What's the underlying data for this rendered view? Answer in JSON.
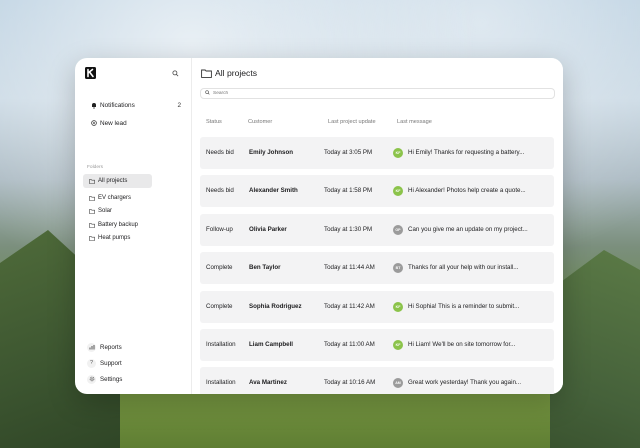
{
  "colors": {
    "accent_green": "#8bc34a",
    "avatar_gray": "#9b9b9b",
    "active_folder_bg": "#e9e9ea",
    "row_bg": "#f3f3f4"
  },
  "sidebar": {
    "logo_icon": "brand-logo-icon",
    "search_icon": "search-icon",
    "notifications": {
      "label": "Notifications",
      "count": "2",
      "icon": "bell-icon"
    },
    "new_lead": {
      "label": "New lead",
      "icon": "plus-circle-icon"
    },
    "folders_label": "Folders",
    "folders": [
      {
        "label": "All projects",
        "icon": "folder-icon",
        "active": true
      },
      {
        "label": "EV chargers",
        "icon": "folder-icon"
      },
      {
        "label": "Solar",
        "icon": "folder-icon"
      },
      {
        "label": "Battery backup",
        "icon": "folder-icon"
      },
      {
        "label": "Heat pumps",
        "icon": "folder-icon"
      }
    ],
    "bottom": [
      {
        "label": "Reports",
        "icon": "chart-icon"
      },
      {
        "label": "Support",
        "icon": "help-icon"
      },
      {
        "label": "Settings",
        "icon": "gear-icon"
      }
    ]
  },
  "main": {
    "title": "All projects",
    "search_placeholder": "Search",
    "columns": [
      "Status",
      "Customer",
      "Last project update",
      "Last message"
    ],
    "rows": [
      {
        "status": "Needs bid",
        "customer": "Emily Johnson",
        "updated": "Today at 3:05 PM",
        "avatar": "KF",
        "avatar_color": "#8bc34a",
        "message": "Hi Emily! Thanks for requesting a battery..."
      },
      {
        "status": "Needs bid",
        "customer": "Alexander Smith",
        "updated": "Today at 1:58 PM",
        "avatar": "KF",
        "avatar_color": "#8bc34a",
        "message": "Hi Alexander! Photos help create a quote..."
      },
      {
        "status": "Follow-up",
        "customer": "Olivia Parker",
        "updated": "Today at 1:30 PM",
        "avatar": "OP",
        "avatar_color": "#9b9b9b",
        "message": "Can you give me an update on my project..."
      },
      {
        "status": "Complete",
        "customer": "Ben Taylor",
        "updated": "Today at 11:44 AM",
        "avatar": "BT",
        "avatar_color": "#9b9b9b",
        "message": "Thanks for all your help with our install..."
      },
      {
        "status": "Complete",
        "customer": "Sophia Rodriguez",
        "updated": "Today at 11:42 AM",
        "avatar": "KF",
        "avatar_color": "#8bc34a",
        "message": "Hi Sophia! This is a reminder to submit..."
      },
      {
        "status": "Installation",
        "customer": "Liam Campbell",
        "updated": "Today at 11:00 AM",
        "avatar": "KF",
        "avatar_color": "#8bc34a",
        "message": "Hi Liam! We'll be on site tomorrow for..."
      },
      {
        "status": "Installation",
        "customer": "Ava Martinez",
        "updated": "Today at 10:16 AM",
        "avatar": "AM",
        "avatar_color": "#9b9b9b",
        "message": "Great work yesterday! Thank you again..."
      }
    ]
  }
}
